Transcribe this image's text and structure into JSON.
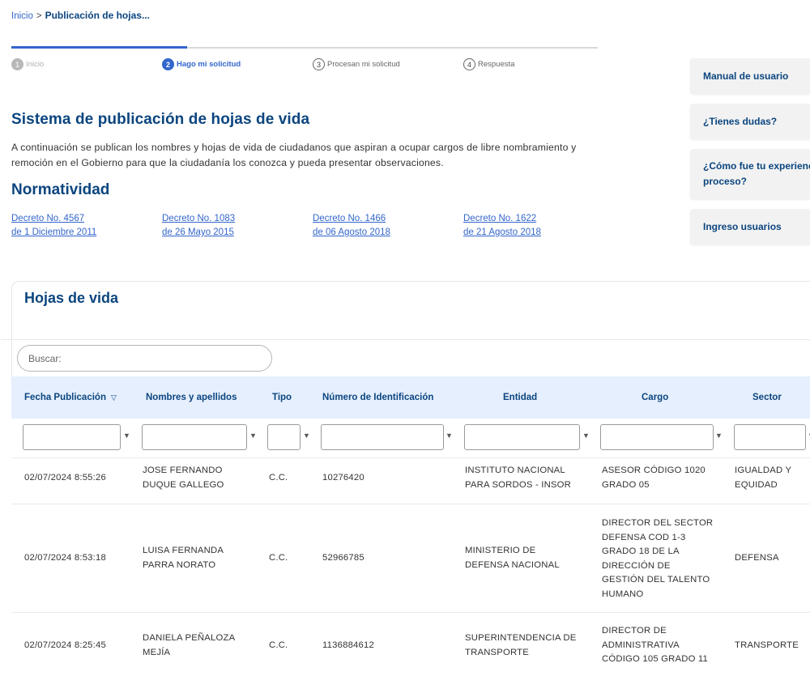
{
  "breadcrumb": {
    "home": "Inicio",
    "separator": ">",
    "current": "Publicación de hojas..."
  },
  "steps": [
    {
      "number": "1",
      "label": "Inicio"
    },
    {
      "number": "2",
      "label": "Hago mi solicitud"
    },
    {
      "number": "3",
      "label": "Procesan mi solicitud"
    },
    {
      "number": "4",
      "label": "Respuesta"
    }
  ],
  "progress_fraction": 0.3,
  "page": {
    "title": "Sistema de publicación de hojas de vida",
    "intro_line1": "A continuación se publican los nombres y hojas de vida de ciudadanos que aspiran a ocupar cargos de libre nombramiento y",
    "intro_line2": "remoción en el Gobierno para que la ciudadanía los conozca y pueda presentar observaciones.",
    "normatividad_title": "Normatividad"
  },
  "decrees": [
    {
      "line1": "Decreto No. 4567",
      "line2": "de 1 Diciembre 2011"
    },
    {
      "line1": "Decreto No. 1083",
      "line2": "de 26 Mayo 2015"
    },
    {
      "line1": "Decreto No. 1466",
      "line2": "de 06 Agosto 2018"
    },
    {
      "line1": "Decreto No. 1622",
      "line2": "de 21 Agosto 2018"
    }
  ],
  "side_menu": [
    {
      "label": "Manual de usuario"
    },
    {
      "label": "¿Tienes dudas?"
    },
    {
      "label": "¿Cómo fue tu experiencia durante el",
      "label2": "proceso?"
    },
    {
      "label": "Ingreso usuarios"
    }
  ],
  "hojas": {
    "title": "Hojas de vida",
    "search_placeholder": "Buscar:",
    "columns": [
      "Fecha Publicación",
      "Nombres y apellidos",
      "Tipo",
      "Número de Identificación",
      "Entidad",
      "Cargo",
      "Sector"
    ],
    "sort_icon": "triangle-down",
    "filter_icon": "funnel",
    "rows": [
      {
        "fecha": "02/07/2024 8:55:26",
        "nombre": [
          "JOSE FERNANDO",
          "DUQUE GALLEGO"
        ],
        "tipo": "C.C.",
        "numero": "10276420",
        "entidad": [
          "INSTITUTO NACIONAL",
          "PARA SORDOS - INSOR"
        ],
        "cargo": [
          "ASESOR CÓDIGO 1020",
          "GRADO 05"
        ],
        "sector": [
          "IGUALDAD Y",
          "EQUIDAD"
        ]
      },
      {
        "fecha": "02/07/2024 8:53:18",
        "nombre": [
          "LUISA FERNANDA",
          "PARRA NORATO"
        ],
        "tipo": "C.C.",
        "numero": "52966785",
        "entidad": [
          "MINISTERIO DE",
          "DEFENSA NACIONAL"
        ],
        "cargo": [
          "DIRECTOR DEL SECTOR",
          "DEFENSA COD 1-3",
          "GRADO 18 DE LA",
          "DIRECCIÓN DE",
          "GESTIÓN DEL TALENTO",
          "HUMANO"
        ],
        "sector": [
          "DEFENSA"
        ]
      },
      {
        "fecha": "02/07/2024 8:25:45",
        "nombre": [
          "DANIELA PEÑALOZA",
          "MEJÍA"
        ],
        "tipo": "C.C.",
        "numero": "1136884612",
        "entidad": [
          "SUPERINTENDENCIA DE",
          "TRANSPORTE"
        ],
        "cargo": [
          "DIRECTOR DE",
          "ADMINISTRATIVA",
          "CÓDIGO 105 GRADO 11"
        ],
        "sector": [
          "TRANSPORTE"
        ]
      }
    ]
  },
  "colors": {
    "brand_blue": "#0b457f",
    "link_blue": "#3366cc",
    "header_bg": "#e6effd"
  }
}
